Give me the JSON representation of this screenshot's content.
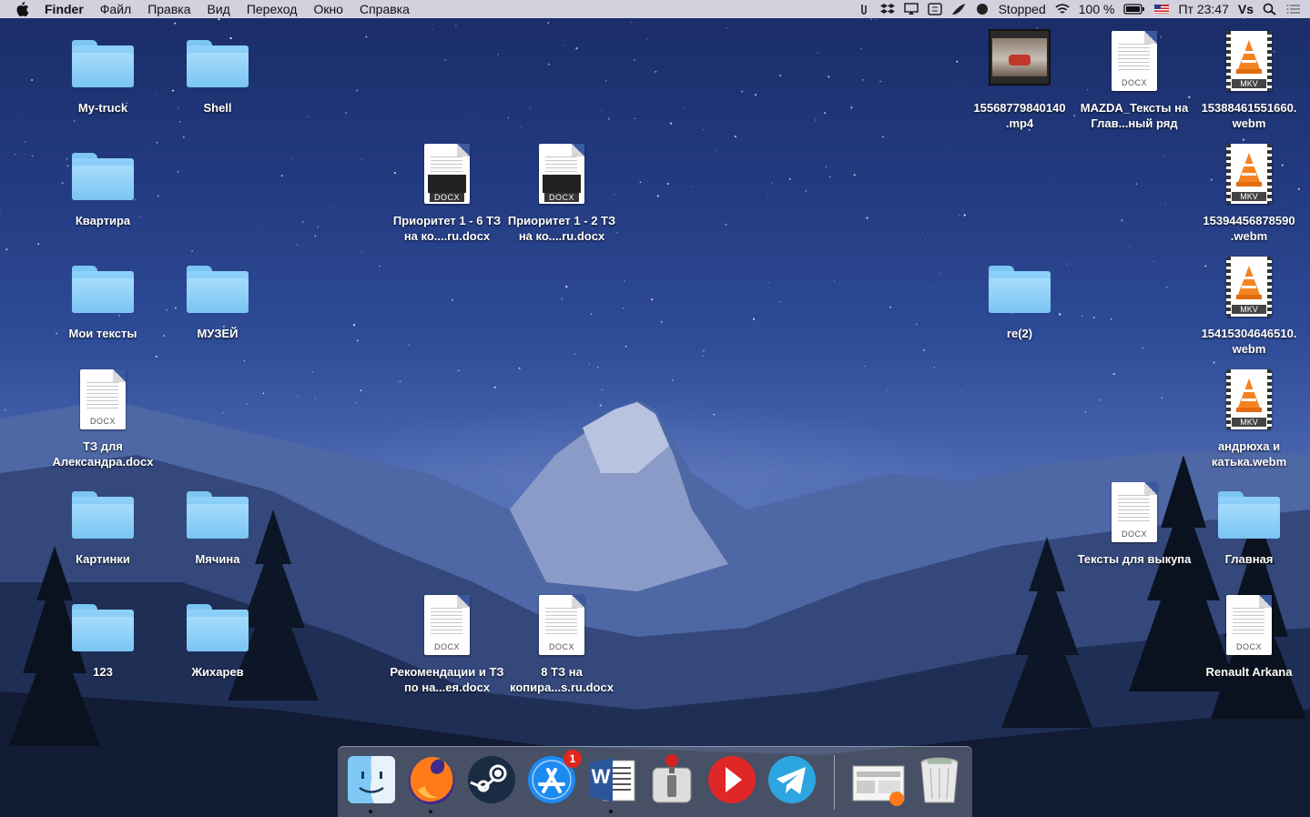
{
  "menubar": {
    "app": "Finder",
    "menus": [
      "Файл",
      "Правка",
      "Вид",
      "Переход",
      "Окно",
      "Справка"
    ],
    "tray": {
      "status": "Stopped",
      "battery": "100 %",
      "clock": "Пт 23:47",
      "user": "Vs"
    }
  },
  "desktop": {
    "left": [
      {
        "label": "My-truck",
        "kind": "folder"
      },
      {
        "label": "Shell",
        "kind": "folder"
      },
      {
        "label": "Квартира",
        "kind": "folder"
      },
      {
        "label": "Мои тексты",
        "kind": "folder"
      },
      {
        "label": "МУЗЕЙ",
        "kind": "folder"
      },
      {
        "label": "ТЗ для Александра.docx",
        "kind": "docx",
        "tag": "DOCX"
      },
      {
        "label": "Картинки",
        "kind": "folder"
      },
      {
        "label": "Мячина",
        "kind": "folder"
      },
      {
        "label": "123",
        "kind": "folder"
      },
      {
        "label": "Жихарев",
        "kind": "folder"
      }
    ],
    "center": [
      {
        "label": "Приоритет 1 - 6 ТЗ на ко....ru.docx",
        "kind": "docx",
        "tag": "DOCX"
      },
      {
        "label": "Приоритет 1 - 2 ТЗ на ко....ru.docx",
        "kind": "docx",
        "tag": "DOCX"
      },
      {
        "label": "Рекомендации и ТЗ по на...ея.docx",
        "kind": "docx",
        "tag": "DOCX"
      },
      {
        "label": "8 ТЗ на копира...s.ru.docx",
        "kind": "docx",
        "tag": "DOCX"
      }
    ],
    "right": [
      {
        "label": "15568779840140 .mp4",
        "kind": "video"
      },
      {
        "label": "MAZDA_Тексты на Глав...ный ряд",
        "kind": "docx",
        "tag": "DOCX"
      },
      {
        "label": "15388461551660. webm",
        "kind": "mkv",
        "tag": "MKV"
      },
      {
        "label": "15394456878590 .webm",
        "kind": "mkv",
        "tag": "MKV"
      },
      {
        "label": "re(2)",
        "kind": "folder"
      },
      {
        "label": "15415304646510. webm",
        "kind": "mkv",
        "tag": "MKV"
      },
      {
        "label": "андрюха и катька.webm",
        "kind": "mkv",
        "tag": "MKV"
      },
      {
        "label": "Тексты для выкупа",
        "kind": "docx",
        "tag": "DOCX"
      },
      {
        "label": "Главная",
        "kind": "folder"
      },
      {
        "label": "Renault Arkana",
        "kind": "docx",
        "tag": "DOCX"
      }
    ]
  },
  "dock": {
    "app_store_badge": "1",
    "word_letter": "W",
    "items": [
      "finder-icon",
      "firefox-icon",
      "steam-icon",
      "app-store-icon",
      "word-icon",
      "transmission-icon",
      "infuse-icon",
      "telegram-icon",
      "downloads-stack-icon",
      "trash-icon"
    ]
  },
  "colors": {
    "folder": "#7ac5f3",
    "vlc_cone": "#f58220",
    "badge": "#e2261c"
  }
}
